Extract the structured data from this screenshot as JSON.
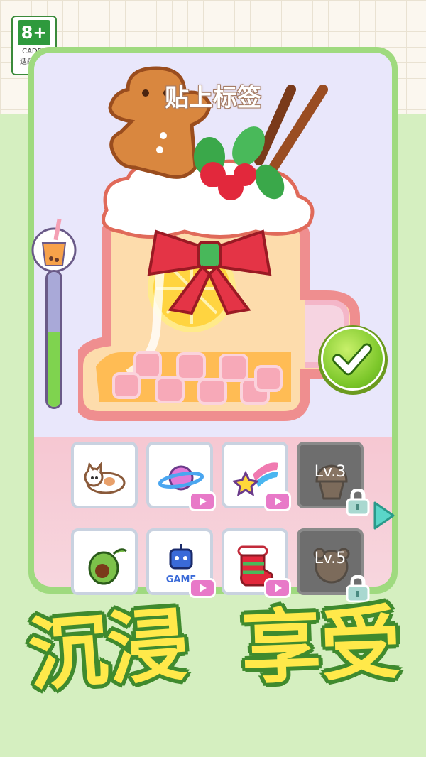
{
  "rating": {
    "age": "8+",
    "brand": "CADPA",
    "tip": "适龄提示"
  },
  "stage": {
    "title": "贴上标签"
  },
  "progress": {
    "value": 0.56
  },
  "confirm": {
    "icon": "check-icon"
  },
  "tiles": [
    {
      "id": "cat",
      "icon": "cat-sticker-icon",
      "ad": false,
      "locked": false,
      "level": ""
    },
    {
      "id": "planet",
      "icon": "planet-sticker-icon",
      "ad": true,
      "locked": false,
      "level": ""
    },
    {
      "id": "star",
      "icon": "shooting-star-sticker-icon",
      "ad": true,
      "locked": false,
      "level": ""
    },
    {
      "id": "cupcake",
      "icon": "cupcake-sticker-icon",
      "ad": false,
      "locked": true,
      "level": "Lv.3"
    },
    {
      "id": "avocado",
      "icon": "avocado-sticker-icon",
      "ad": false,
      "locked": false,
      "level": ""
    },
    {
      "id": "robot",
      "icon": "robot-sticker-icon",
      "ad": true,
      "locked": false,
      "level": "",
      "text": "GAME"
    },
    {
      "id": "stocking",
      "icon": "stocking-sticker-icon",
      "ad": true,
      "locked": false,
      "level": ""
    },
    {
      "id": "bear",
      "icon": "bear-sticker-icon",
      "ad": false,
      "locked": true,
      "level": "Lv.5"
    }
  ],
  "slogan": {
    "left": "沉浸",
    "right": "享受"
  },
  "colors": {
    "accent": "#7cc72a",
    "slogan_fill": "#ffe94a",
    "slogan_stroke": "#3f8a2e",
    "ad_badge": "#e879c8"
  }
}
